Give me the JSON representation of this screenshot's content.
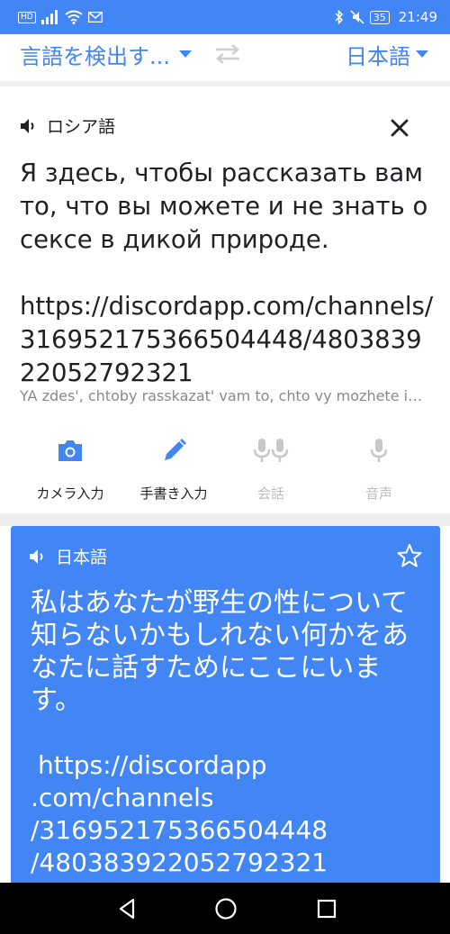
{
  "status_bar": {
    "hd_badge": "HD",
    "battery": "35",
    "time": "21:49"
  },
  "lang_bar": {
    "source_language": "言語を検出す...",
    "target_language": "日本語"
  },
  "input": {
    "detected_language": "ロシア語",
    "source_text": "Я здесь, чтобы рассказать вам то, что вы можете и не знать о сексе в дикой природе.",
    "source_link": "https://discordapp.com/channels/316952175366504448/480383922052792321",
    "romanization": "YA zdes', chtoby rasskazat' vam to, chto vy mozhete i ne znat' o sekse v dikoy prirode.",
    "tools": [
      {
        "label": "カメラ入力",
        "icon": "camera-icon",
        "enabled": true
      },
      {
        "label": "手書き入力",
        "icon": "pen-icon",
        "enabled": true
      },
      {
        "label": "会話",
        "icon": "conversation-mic-icon",
        "enabled": false
      },
      {
        "label": "音声",
        "icon": "mic-icon",
        "enabled": false
      }
    ]
  },
  "result": {
    "language": "日本語",
    "translated_text": "私はあなたが野生の性について知らないかもしれない何かをあなたに話すためにここにいます。",
    "link_lines": [
      "https://discordapp",
      ".com/channels",
      "/316952175366504448",
      "/480383922052792321"
    ]
  },
  "colors": {
    "accent": "#4285f4",
    "text": "#202124",
    "muted": "#8a8a8a",
    "disabled": "#bdbdbd"
  }
}
